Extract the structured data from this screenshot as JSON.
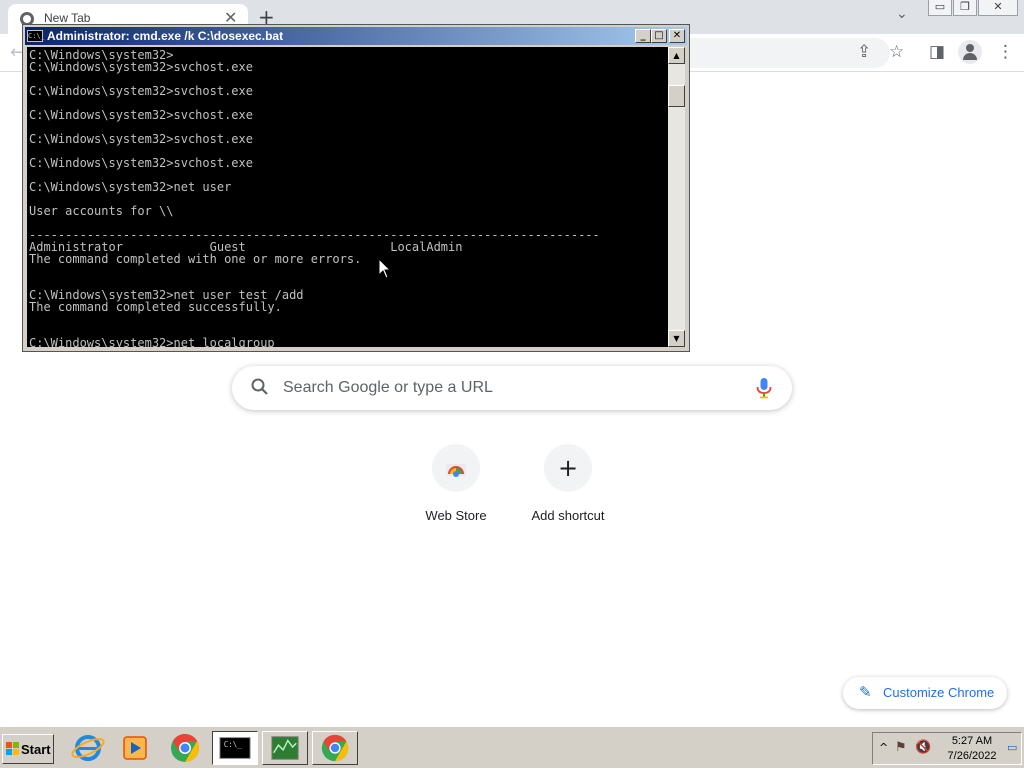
{
  "browser": {
    "tab_title": "New Tab",
    "tab_close": "✕",
    "new_tab": "+",
    "window_min": "▭",
    "window_restore": "❐",
    "window_close": "✕"
  },
  "newtab": {
    "search_placeholder": "Search Google or type a URL",
    "shortcuts": [
      {
        "label": "Web Store",
        "icon": "chrome-web-store-icon"
      },
      {
        "label": "Add shortcut",
        "icon": "plus-icon"
      }
    ],
    "customize_label": "Customize Chrome"
  },
  "cmd": {
    "title": "Administrator: cmd.exe /k C:\\dosexec.bat",
    "title_icon_text": "C:\\_",
    "lines": [
      "C:\\Windows\\system32>",
      "C:\\Windows\\system32>svchost.exe",
      "",
      "C:\\Windows\\system32>svchost.exe",
      "",
      "C:\\Windows\\system32>svchost.exe",
      "",
      "C:\\Windows\\system32>svchost.exe",
      "",
      "C:\\Windows\\system32>svchost.exe",
      "",
      "C:\\Windows\\system32>net user",
      "",
      "User accounts for \\\\",
      "",
      "-------------------------------------------------------------------------------",
      "Administrator            Guest                    LocalAdmin",
      "The command completed with one or more errors.",
      "",
      "",
      "C:\\Windows\\system32>net user test /add",
      "The command completed successfully.",
      "",
      "",
      "C:\\Windows\\system32>net localgroup _"
    ]
  },
  "taskbar": {
    "start_label": "Start",
    "apps": [
      {
        "name": "internet-explorer",
        "active": false
      },
      {
        "name": "media-player",
        "active": false
      },
      {
        "name": "chrome",
        "active": false
      },
      {
        "name": "command-prompt",
        "active": true
      },
      {
        "name": "task-manager",
        "active": false
      },
      {
        "name": "chrome",
        "active": false
      }
    ],
    "time": "5:27 AM",
    "date": "7/26/2022"
  }
}
